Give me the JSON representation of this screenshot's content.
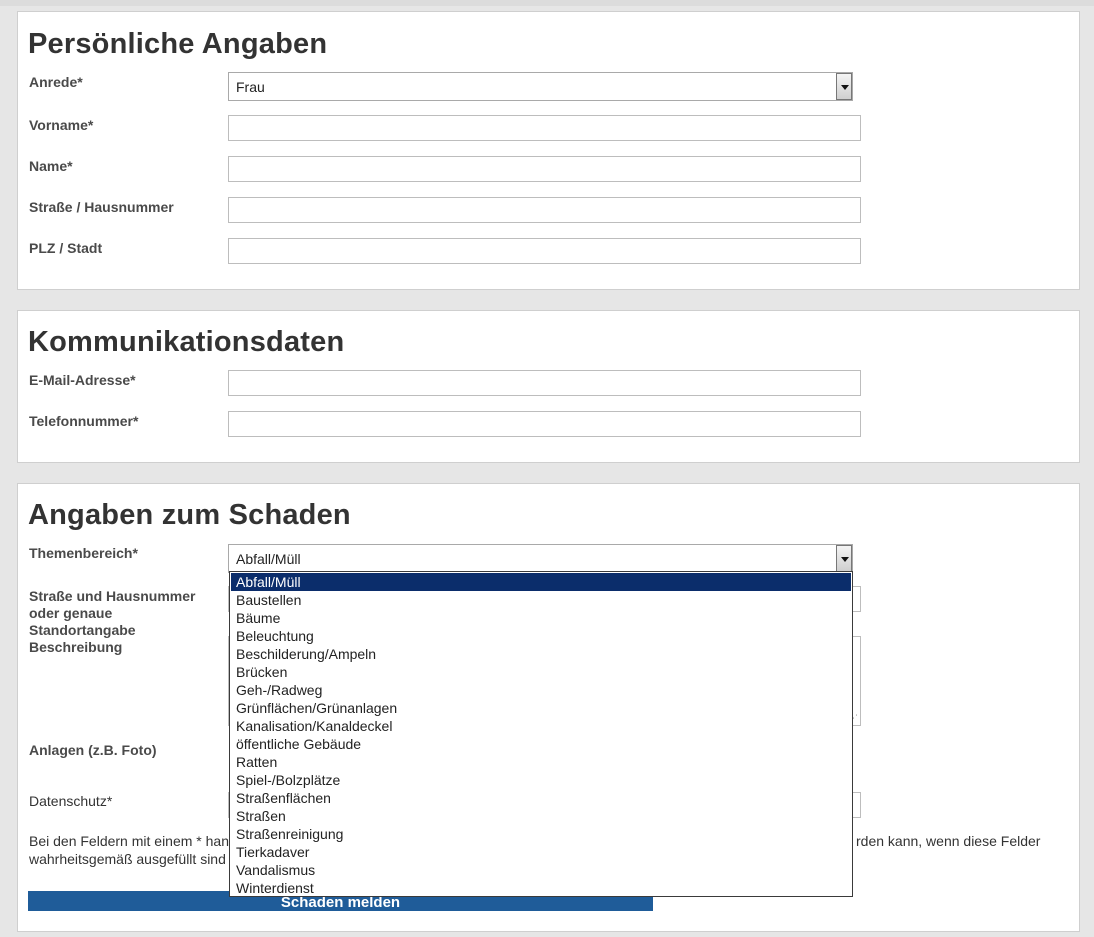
{
  "section1": {
    "title": "Persönliche Angaben",
    "anrede_label": "Anrede*",
    "anrede_value": "Frau",
    "vorname_label": "Vorname*",
    "name_label": "Name*",
    "strasse_label": "Straße / Hausnummer",
    "plz_label": "PLZ / Stadt"
  },
  "section2": {
    "title": "Kommunikationsdaten",
    "email_label": "E-Mail-Adresse*",
    "telefon_label": "Telefonnummer*"
  },
  "section3": {
    "title": "Angaben zum Schaden",
    "thema_label": "Themenbereich*",
    "thema_value": "Abfall/Müll",
    "standort_label_1": "Straße und Hausnummer",
    "standort_label_2": "oder genaue",
    "standort_label_3": "Standortangabe",
    "beschreibung_label": "Beschreibung",
    "anlagen_label": "Anlagen (z.B. Foto)",
    "datenschutz_label": "Datenschutz*",
    "note_line1_left": "Bei den Feldern mit einem * han",
    "note_line1_right": "rden kann, wenn diese Felder",
    "note_line2_left": "wahrheitsgemäß ausgefüllt sind",
    "submit_label": "Schaden melden",
    "options": [
      "Abfall/Müll",
      "Baustellen",
      "Bäume",
      "Beleuchtung",
      "Beschilderung/Ampeln",
      "Brücken",
      "Geh-/Radweg",
      "Grünflächen/Grünanlagen",
      "Kanalisation/Kanaldeckel",
      "öffentliche Gebäude",
      "Ratten",
      "Spiel-/Bolzplätze",
      "Straßenflächen",
      "Straßen",
      "Straßenreinigung",
      "Tierkadaver",
      "Vandalismus",
      "Winterdienst"
    ]
  },
  "colors": {
    "selected_option_bg": "#0b2d6b",
    "submit_bg": "#1f5c99"
  }
}
